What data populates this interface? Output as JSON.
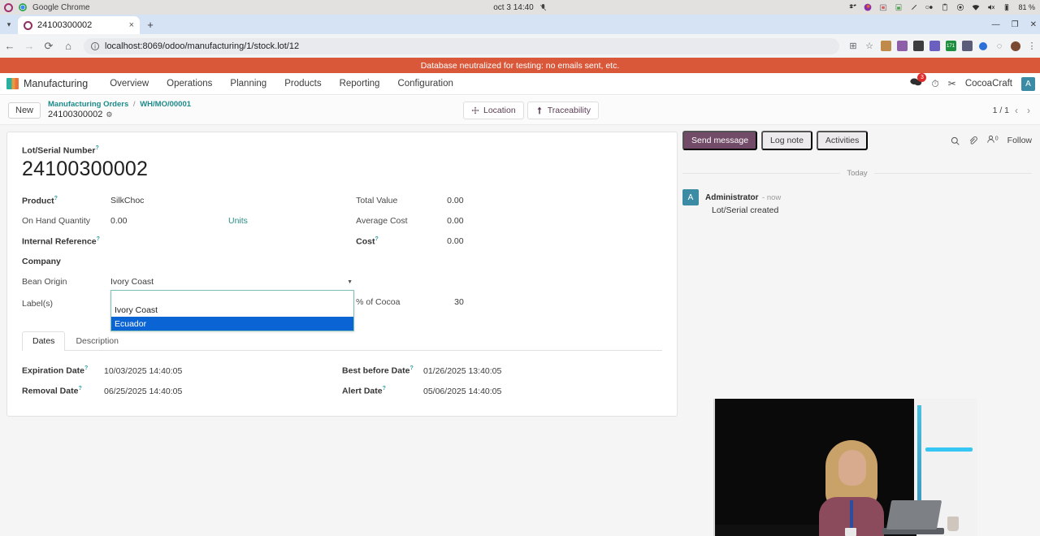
{
  "os": {
    "app_menu": "Google Chrome",
    "clock": "oct 3  14:40",
    "battery": "81 %",
    "tray_icons": [
      "mic-muted-icon",
      "dropbox-icon",
      "firefox-icon",
      "calendar-icon",
      "battery-widget-icon",
      "pencil-icon",
      "toggle-icon",
      "clipboard-icon",
      "record-icon",
      "wifi-icon",
      "volume-muted-icon",
      "battery-icon"
    ]
  },
  "browser": {
    "tab_title": "24100300002",
    "new_tab_label": "+",
    "close_label": "×",
    "url": "localhost:8069/odoo/manufacturing/1/stock.lot/12",
    "back_label": "←",
    "forward_label": "→",
    "reload_label": "⟳",
    "home_label": "⌂",
    "info_label": "i",
    "window_min": "—",
    "window_max": "❐",
    "window_close": "✕",
    "extension_badge": "171",
    "menu_label": "⋮"
  },
  "banner": {
    "text": "Database neutralized for testing: no emails sent, etc.",
    "color": "#d9583a"
  },
  "navbar": {
    "app_name": "Manufacturing",
    "items": [
      "Overview",
      "Operations",
      "Planning",
      "Products",
      "Reporting",
      "Configuration"
    ],
    "messages_badge": "3",
    "user_name": "CocoaCraft",
    "avatar_letter": "A"
  },
  "control_panel": {
    "new_button": "New",
    "breadcrumb_root": "Manufacturing Orders",
    "breadcrumb_sep": "/",
    "breadcrumb_parent": "WH/MO/00001",
    "breadcrumb_current": "24100300002",
    "buttons": [
      {
        "label": "Location",
        "icon": "arrows-move-icon"
      },
      {
        "label": "Traceability",
        "icon": "arrow-up-icon"
      }
    ],
    "pager": "1 / 1",
    "pager_prev": "‹",
    "pager_next": "›"
  },
  "form": {
    "title_label": "Lot/Serial Number",
    "title_value": "24100300002",
    "left_fields": [
      {
        "label": "Product",
        "value": "SilkChoc",
        "bold": true,
        "help": true
      },
      {
        "label": "On Hand Quantity",
        "value": "0.00",
        "bold": false,
        "help": false,
        "suffix": "Units"
      },
      {
        "label": "Internal Reference",
        "value": "",
        "bold": true,
        "help": true
      },
      {
        "label": "Company",
        "value": "",
        "bold": true,
        "help": false
      }
    ],
    "right_fields": [
      {
        "label": "Total Value",
        "value": "0.00",
        "bold": false,
        "help": false
      },
      {
        "label": "Average Cost",
        "value": "0.00",
        "bold": false,
        "help": false
      },
      {
        "label": "Cost",
        "value": "0.00",
        "bold": true,
        "help": true
      }
    ],
    "bean_origin_label": "Bean Origin",
    "bean_origin_value": "Ivory Coast",
    "bean_origin_options": [
      "",
      "Ivory Coast",
      "Ecuador"
    ],
    "bean_origin_highlighted": "Ecuador",
    "labels_label": "Label(s)",
    "cocoa_label": "% of Cocoa",
    "cocoa_value": "30",
    "tabs": [
      {
        "label": "Dates",
        "active": true
      },
      {
        "label": "Description",
        "active": false
      }
    ],
    "date_fields_left": [
      {
        "label": "Expiration Date",
        "value": "10/03/2025 14:40:05"
      },
      {
        "label": "Removal Date",
        "value": "06/25/2025 14:40:05"
      }
    ],
    "date_fields_right": [
      {
        "label": "Best before Date",
        "value": "01/26/2025 13:40:05"
      },
      {
        "label": "Alert Date",
        "value": "05/06/2025 14:40:05"
      }
    ]
  },
  "chatter": {
    "send_message": "Send message",
    "log_note": "Log note",
    "activities": "Activities",
    "follower_count": "0",
    "follow_label": "Follow",
    "day_separator": "Today",
    "messages": [
      {
        "avatar": "A",
        "author": "Administrator",
        "time": "- now",
        "body": "Lot/Serial created"
      }
    ]
  }
}
